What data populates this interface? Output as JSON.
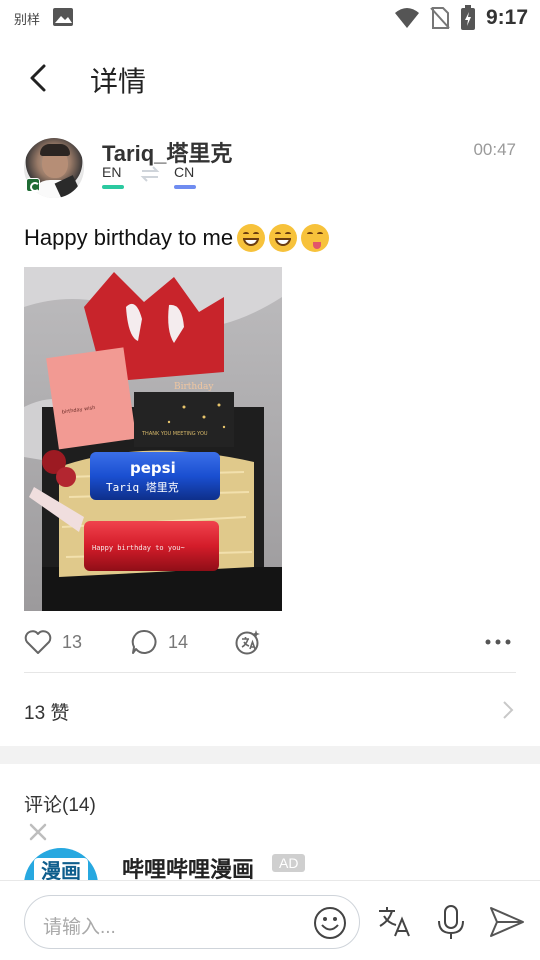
{
  "status_bar": {
    "app_label": "别样",
    "time": "9:17",
    "icons": [
      "image-icon",
      "wifi-icon",
      "no-sim-icon",
      "battery-charging-icon"
    ]
  },
  "header": {
    "title": "详情",
    "back_icon": "chevron-left-icon"
  },
  "post": {
    "author": "Tariq_塔里克",
    "time": "00:47",
    "native_language": "EN",
    "learning_language": "CN",
    "text": "Happy birthday to me",
    "emojis": [
      "grinning-face-emoji",
      "grinning-face-emoji",
      "winking-tongue-emoji"
    ],
    "image": {
      "pepsi_brand": "pepsi",
      "pepsi_name": "Tariq 塔里克",
      "red_can_text": "Happy birthday to you~",
      "card_text": "THANK YOU MEETING YOU",
      "crown_text": "Birthday"
    },
    "likes_count": "13",
    "comments_count": "14",
    "likes_summary": "13 赞"
  },
  "comments": {
    "title": "评论(14)",
    "ad": {
      "name": "哔哩哔哩漫画",
      "badge": "AD",
      "avatar_text": "漫画"
    }
  },
  "composer": {
    "placeholder": "请输入..."
  },
  "colors": {
    "en_accent": "#2bc9a0",
    "cn_accent": "#6f8cf0",
    "pepsi_blue": "#1a4fd1",
    "can_red": "#d41c2a"
  }
}
